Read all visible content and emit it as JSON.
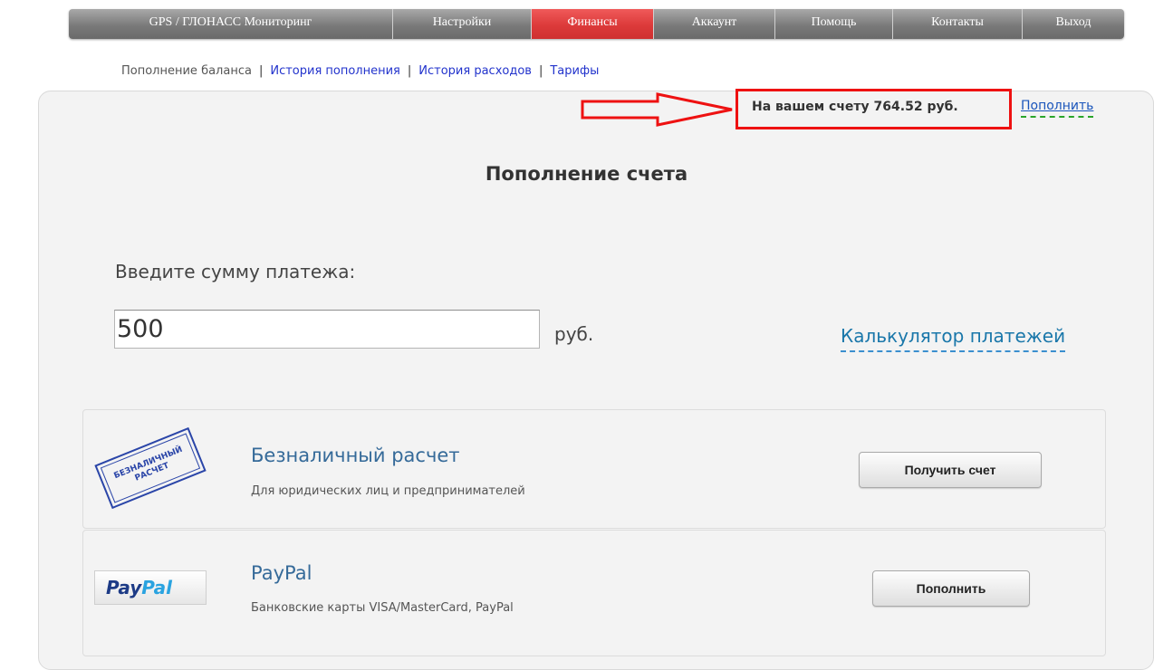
{
  "nav": {
    "items": [
      {
        "label": "GPS / ГЛОНАСС Мониторинг",
        "active": false
      },
      {
        "label": "Настройки",
        "active": false
      },
      {
        "label": "Финансы",
        "active": true
      },
      {
        "label": "Аккаунт",
        "active": false
      },
      {
        "label": "Помощь",
        "active": false
      },
      {
        "label": "Контакты",
        "active": false
      },
      {
        "label": "Выход",
        "active": false
      }
    ]
  },
  "subnav": {
    "current": "Пополнение баланса",
    "separator": "|",
    "links": [
      "История пополнения",
      "История расходов",
      "Тарифы"
    ]
  },
  "balance": {
    "text": "На вашем счету 764.52 руб.",
    "topup_link": "Пополнить"
  },
  "heading": "Пополнение счета",
  "amount": {
    "label": "Введите сумму платежа:",
    "value": "500",
    "currency": "руб.",
    "calculator_link": "Калькулятор платежей"
  },
  "payment_methods": [
    {
      "title": "Безналичный расчет",
      "subtitle": "Для юридических лиц и предпринимателей",
      "button": "Получить счет",
      "logo_line1": "БЕЗНАЛИЧНЫЙ",
      "logo_line2": "РАСЧЕТ"
    },
    {
      "title": "PayPal",
      "subtitle": "Банковские карты VISA/MasterCard, PayPal",
      "button": "Пополнить",
      "logo_part1": "Pay",
      "logo_part2": "Pal"
    }
  ],
  "colors": {
    "nav_active": "#dc3a3a",
    "highlight_red": "#ee1111",
    "link_blue": "#2233cc"
  }
}
